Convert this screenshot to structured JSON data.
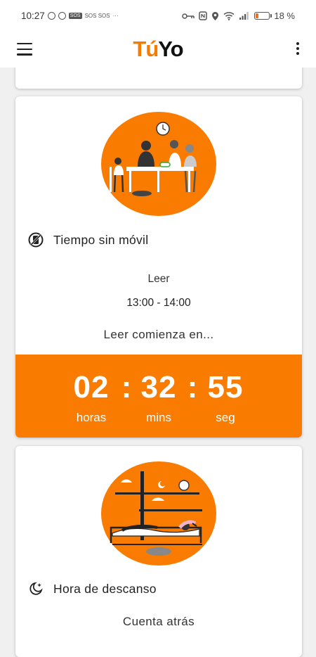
{
  "status_bar": {
    "time": "10:27",
    "sos_badge": "SOS",
    "sos_text": "SOS SOS",
    "more": "···",
    "battery": "18 %",
    "battery_level": 0.18
  },
  "app_bar": {
    "logo_part1": "Tú",
    "logo_part2": "Yo"
  },
  "cards": {
    "main": {
      "title": "Tiempo sin móvil",
      "activity": "Leer",
      "time_range": "13:00 - 14:00",
      "starts_in": "Leer comienza en...",
      "countdown": {
        "hours": "02",
        "minutes": "32",
        "seconds": "55",
        "separator": ":",
        "hours_label": "horas",
        "minutes_label": "mins",
        "seconds_label": "seg"
      }
    },
    "rest": {
      "title": "Hora de descanso",
      "subtitle": "Cuenta atrás"
    }
  },
  "colors": {
    "accent": "#f97c00",
    "logo_orange": "#f57c00",
    "text": "#222222",
    "background": "#f0f0f0"
  },
  "icons": {
    "menu": "hamburger-menu-icon",
    "more": "more-vert-icon",
    "no_phone": "no-phone-icon",
    "rest": "moon-star-icon"
  }
}
